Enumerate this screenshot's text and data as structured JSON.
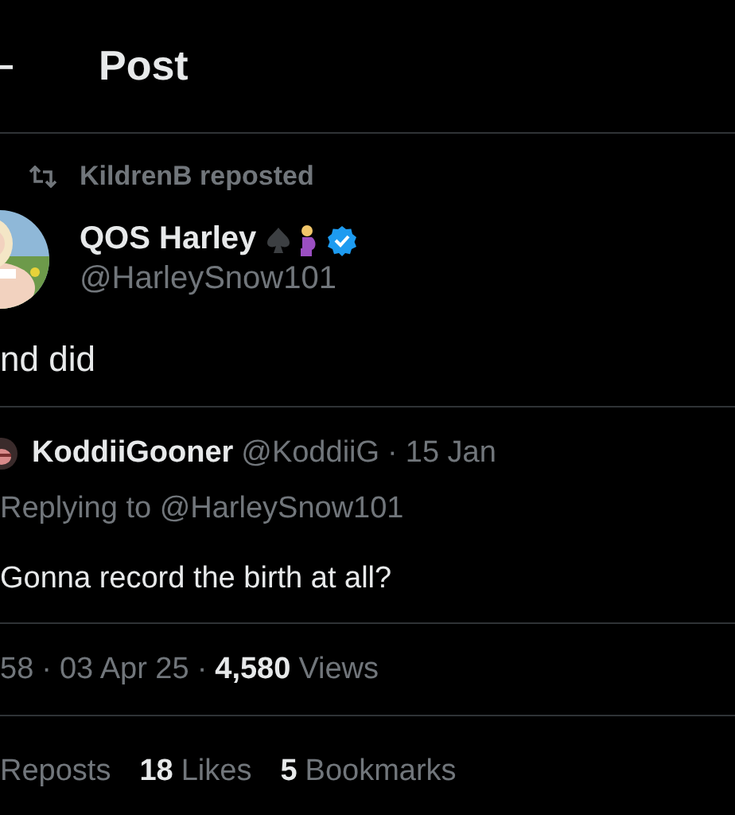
{
  "header": {
    "title": "Post"
  },
  "repost": {
    "text": "KildrenB reposted"
  },
  "post": {
    "author_name": "QOS Harley",
    "handle": "@HarleySnow101",
    "verified": true,
    "text": "nd did"
  },
  "reply": {
    "author_name": "KoddiiGooner",
    "handle": "@KoddiiG",
    "separator": "·",
    "date": "15 Jan",
    "replying_to": "Replying to @HarleySnow101",
    "text": "Gonna record the birth at all?"
  },
  "meta": {
    "time": "58",
    "separator_1": "·",
    "date": "03 Apr 25",
    "separator_2": "·",
    "views_count": "4,580",
    "views_label": "Views"
  },
  "stats": [
    {
      "label": "Reposts"
    },
    {
      "count": "18",
      "label": "Likes"
    },
    {
      "count": "5",
      "label": "Bookmarks"
    }
  ]
}
